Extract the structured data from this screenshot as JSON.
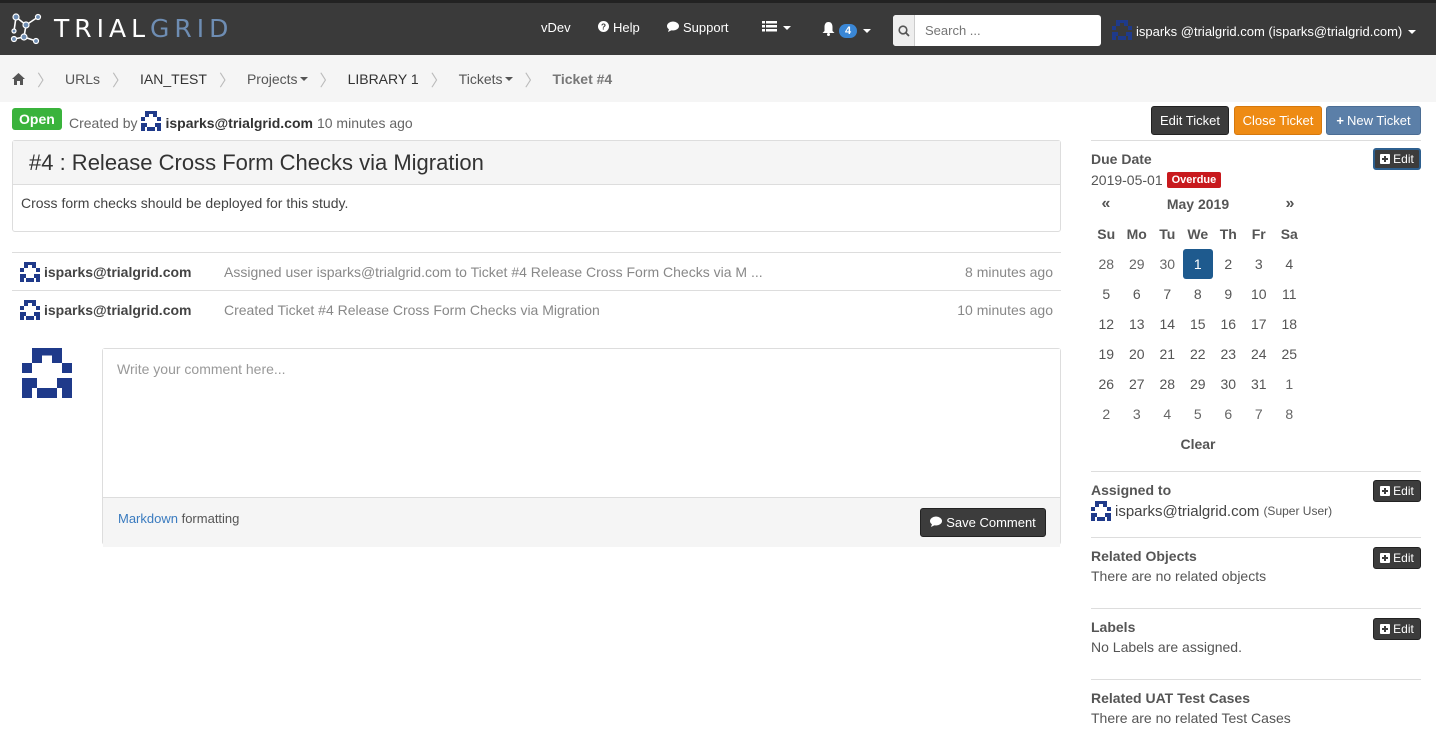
{
  "nav": {
    "logo_part1": "TRIAL",
    "logo_part2": "GRID",
    "vdev": "vDev",
    "help": "Help",
    "support": "Support",
    "notification_count": "4",
    "search_placeholder": "Search ...",
    "user": "isparks @trialgrid.com (isparks@trialgrid.com)"
  },
  "breadcrumb": {
    "items": [
      "URLs",
      "IAN_TEST",
      "Projects",
      "LIBRARY 1",
      "Tickets",
      "Ticket #4"
    ]
  },
  "ticket": {
    "status": "Open",
    "created_by_prefix": "Created by",
    "created_by_user": "isparks@trialgrid.com",
    "created_ago": "10 minutes ago",
    "title": "#4 : Release Cross Form Checks via Migration",
    "description": "Cross form checks should be deployed for this study."
  },
  "buttons": {
    "edit_ticket": "Edit Ticket",
    "close_ticket": "Close Ticket",
    "new_ticket": "New Ticket",
    "save_comment": "Save Comment",
    "edit": "Edit"
  },
  "activity": [
    {
      "user": "isparks@trialgrid.com",
      "text": "Assigned user isparks@trialgrid.com to Ticket #4 Release Cross Form Checks via M ...",
      "time": "8 minutes ago"
    },
    {
      "user": "isparks@trialgrid.com",
      "text": "Created Ticket #4 Release Cross Form Checks via Migration",
      "time": "10 minutes ago"
    }
  ],
  "comment": {
    "placeholder": "Write your comment here...",
    "markdown_link": "Markdown",
    "markdown_suffix": "formatting"
  },
  "sidebar": {
    "due_date_label": "Due Date",
    "due_date_value": "2019-05-01",
    "overdue": "Overdue",
    "calendar": {
      "prev": "«",
      "month": "May 2019",
      "next": "»",
      "days_of_week": [
        "Su",
        "Mo",
        "Tu",
        "We",
        "Th",
        "Fr",
        "Sa"
      ],
      "weeks": [
        [
          "28",
          "29",
          "30",
          "1",
          "2",
          "3",
          "4"
        ],
        [
          "5",
          "6",
          "7",
          "8",
          "9",
          "10",
          "11"
        ],
        [
          "12",
          "13",
          "14",
          "15",
          "16",
          "17",
          "18"
        ],
        [
          "19",
          "20",
          "21",
          "22",
          "23",
          "24",
          "25"
        ],
        [
          "26",
          "27",
          "28",
          "29",
          "30",
          "31",
          "1"
        ],
        [
          "2",
          "3",
          "4",
          "5",
          "6",
          "7",
          "8"
        ]
      ],
      "selected": "1",
      "clear": "Clear"
    },
    "assigned_label": "Assigned to",
    "assigned_user": "isparks@trialgrid.com",
    "assigned_role": "(Super User)",
    "related_objects_label": "Related Objects",
    "related_objects_text": "There are no related objects",
    "labels_label": "Labels",
    "labels_text": "No Labels are assigned.",
    "uat_label": "Related UAT Test Cases",
    "uat_text": "There are no related Test Cases"
  },
  "colors": {
    "navbar": "#3a3a3a",
    "open_badge": "#3ab33c",
    "close_button": "#ee8b14",
    "new_button": "#5b7fa8",
    "overdue": "#c8191d",
    "selected_day": "#1e5a8e"
  }
}
